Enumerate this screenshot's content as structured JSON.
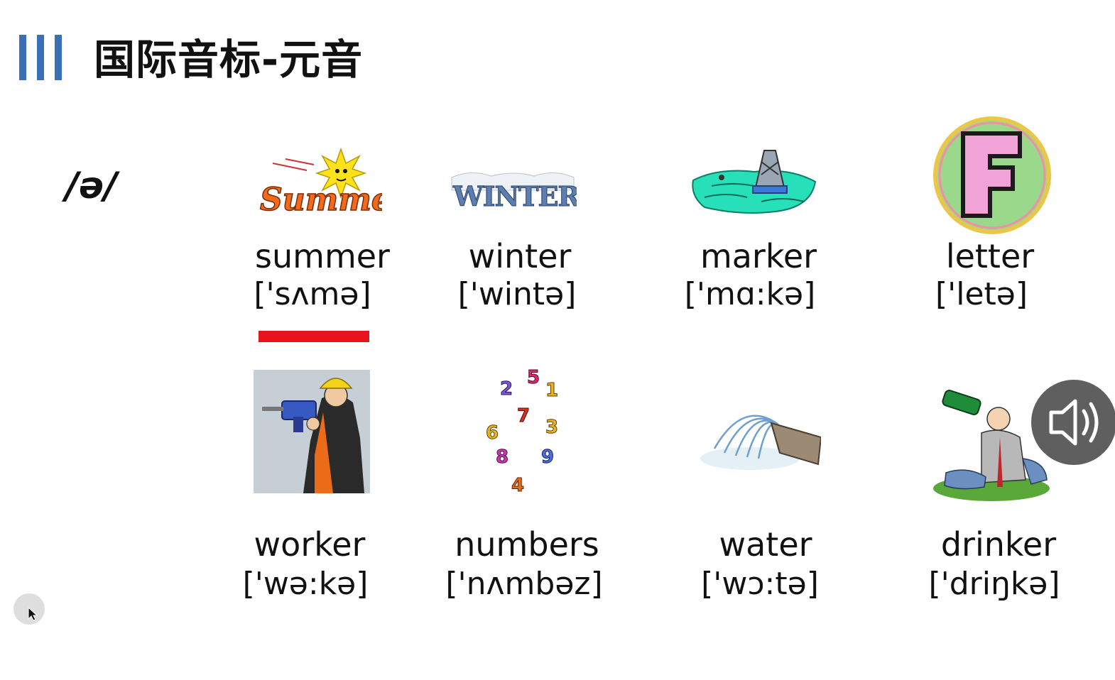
{
  "header": {
    "title": "国际音标-元音"
  },
  "phoneme": "/ə/",
  "words": [
    {
      "word": "summer",
      "ipa": "['sʌmə]",
      "image": "summer-clipart-icon"
    },
    {
      "word": "winter",
      "ipa": "['wintə]",
      "image": "winter-clipart-icon"
    },
    {
      "word": "marker",
      "ipa": "['mɑ:kə]",
      "image": "buoy-marker-clipart-icon"
    },
    {
      "word": "letter",
      "ipa": "['letə]",
      "image": "letter-f-clipart-icon"
    },
    {
      "word": "worker",
      "ipa": "['wə:kə]",
      "image": "worker-drill-clipart-icon"
    },
    {
      "word": "numbers",
      "ipa": "['nʌmbəz]",
      "image": "numbers-clipart-icon"
    },
    {
      "word": "water",
      "ipa": "['wɔ:tə]",
      "image": "water-fountain-clipart-icon"
    },
    {
      "word": "drinker",
      "ipa": "['driŋkə]",
      "image": "drinker-clipart-icon"
    }
  ],
  "picture_text": {
    "summer": "Summer",
    "winter": "WINTER",
    "letter": "F",
    "digits": [
      "5",
      "2",
      "1",
      "7",
      "6",
      "3",
      "8",
      "9",
      "4"
    ]
  },
  "colors": {
    "accent_bar": "#3a70b5",
    "underline": "#e8141b",
    "speaker_bg": "#5f5f5f"
  },
  "controls": {
    "speaker": "speaker-icon",
    "cursor": "mouse-cursor-icon"
  }
}
